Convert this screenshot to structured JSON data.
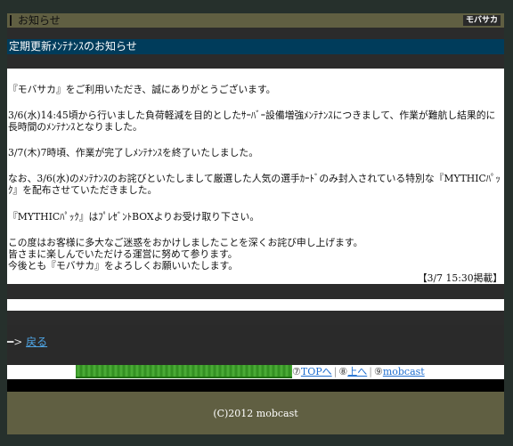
{
  "header": {
    "title": "お知らせ",
    "logo_text": "モバサカ"
  },
  "notice": {
    "title": "定期更新ﾒﾝﾃﾅﾝｽのお知らせ",
    "paragraphs": [
      "『モバサカ』をご利用いただき、誠にありがとうございます。",
      "3/6(水)14:45頃から行いました負荷軽減を目的としたｻｰﾊﾞｰ設備増強ﾒﾝﾃﾅﾝｽにつきまして、作業が難航し結果的に長時間のﾒﾝﾃﾅﾝｽとなりました。",
      "3/7(木)7時頃、作業が完了しﾒﾝﾃﾅﾝｽを終了いたしました。",
      "なお、3/6(水)のﾒﾝﾃﾅﾝｽのお詫びといたしまして厳選した人気の選手ｶｰﾄﾞのみ封入されている特別な『MYTHICﾊﾟｯｸ』を配布させていただきました。",
      "『MYTHICﾊﾟｯｸ』はﾌﾟﾚｾﾞﾝﾄBOXよりお受け取り下さい。",
      "この度はお客様に多大なご迷惑をおかけしましたことを深くお詫び申し上げます。\n皆さまに楽しんでいただける運営に努めて参ります。\n今後とも『モバサカ』をよろしくお願いいたします。"
    ],
    "posted": "【3/7 15:30掲載】"
  },
  "back": {
    "arrow": "━>",
    "label": "戻る"
  },
  "nav": {
    "top_prefix": "⑦",
    "top_label": "TOPへ",
    "up_prefix": "⑧",
    "up_label": "上へ",
    "mob_prefix": "⑨",
    "mob_label": "mobcast",
    "separator": "|"
  },
  "footer": {
    "copyright": "(C)2012 mobcast"
  },
  "colors": {
    "header_bg": "#605f42",
    "title_bar_bg": "#003c5b",
    "link": "#1f6fd1"
  }
}
